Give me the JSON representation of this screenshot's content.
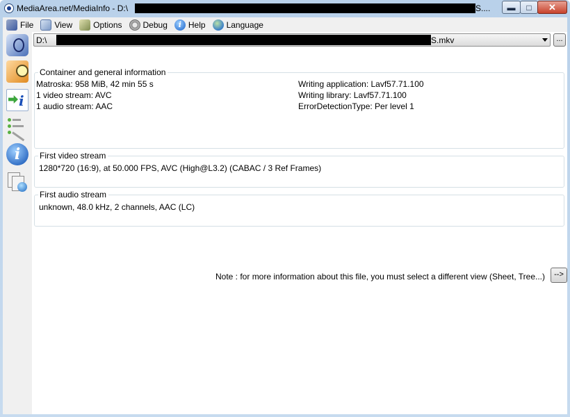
{
  "window": {
    "title_prefix": "MediaArea.net/MediaInfo - D:\\",
    "title_suffix": "S....",
    "minimize_glyph": "▬",
    "maximize_glyph": "□",
    "close_glyph": "✕"
  },
  "menubar": {
    "items": [
      {
        "label": "File",
        "icon": "file-icon"
      },
      {
        "label": "View",
        "icon": "view-icon"
      },
      {
        "label": "Options",
        "icon": "options-icon"
      },
      {
        "label": "Debug",
        "icon": "debug-icon"
      },
      {
        "label": "Help",
        "icon": "help-icon"
      },
      {
        "label": "Language",
        "icon": "language-icon"
      }
    ]
  },
  "sidebar": {
    "icons": [
      "open-file-icon",
      "open-folder-icon",
      "export-icon",
      "preferences-icon",
      "about-icon",
      "knowledge-base-icon"
    ],
    "info_glyph": "i"
  },
  "file_selector": {
    "prefix": "D:\\",
    "suffix": "S.mkv",
    "browse_label": "..."
  },
  "general": {
    "title": "Container and general information",
    "left": [
      "Matroska: 958 MiB, 42 min 55 s",
      "1 video stream: AVC",
      "1 audio stream: AAC"
    ],
    "right": [
      "Writing application: Lavf57.71.100",
      "Writing library: Lavf57.71.100",
      "ErrorDetectionType: Per level 1"
    ]
  },
  "video": {
    "title": "First video stream",
    "info": "1280*720 (16:9), at 50.000 FPS, AVC (High@L3.2) (CABAC / 3 Ref Frames)"
  },
  "audio": {
    "title": "First audio stream",
    "info": "unknown, 48.0 kHz, 2 channels, AAC (LC)"
  },
  "note": {
    "text": "Note : for more information about this file, you must select a different view (Sheet, Tree...)",
    "button_label": "-->"
  }
}
